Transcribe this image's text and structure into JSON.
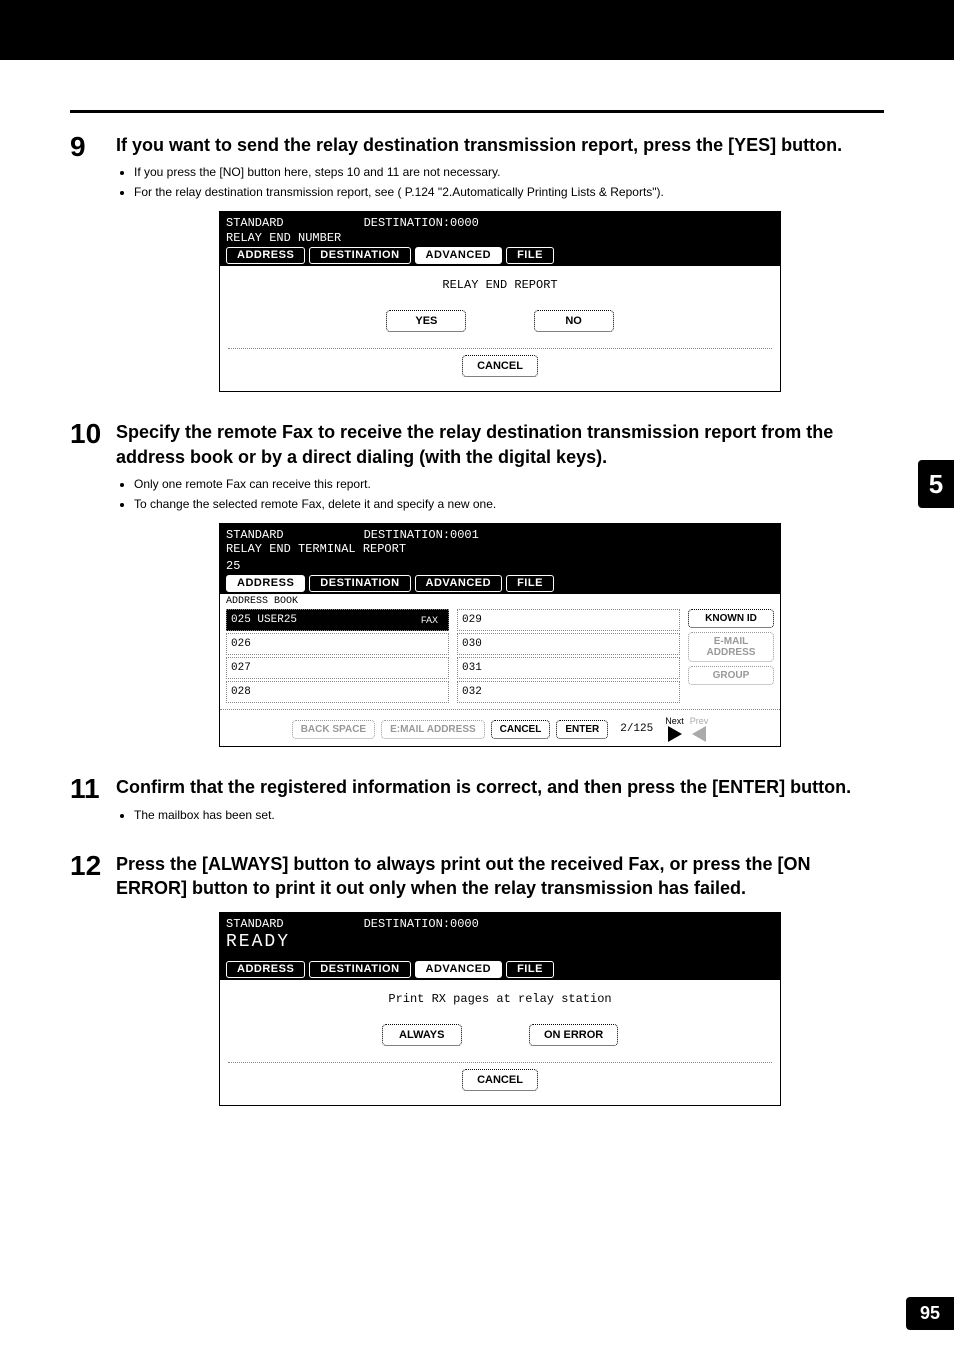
{
  "side_tab": "5",
  "page_number": "95",
  "steps": {
    "s9": {
      "num": "9",
      "title": "If you want to send the relay destination transmission report, press the [YES] button.",
      "bullets": [
        "If you press the [NO] button here, steps 10 and 11 are not necessary.",
        "For the relay destination transmission report, see ( P.124 \"2.Automatically Printing Lists & Reports\")."
      ]
    },
    "s10": {
      "num": "10",
      "title": "Specify the remote Fax to receive the relay destination transmission report from the address book or by a direct dialing (with the digital keys).",
      "bullets": [
        "Only one remote Fax can receive this report.",
        "To change the selected remote Fax, delete it and specify a new one."
      ]
    },
    "s11": {
      "num": "11",
      "title": "Confirm that the registered information is correct, and then press the [ENTER] button.",
      "bullets": [
        "The mailbox has been set."
      ]
    },
    "s12": {
      "num": "12",
      "title": "Press the [ALWAYS] button to always print out the received Fax, or press the [ON ERROR] button to print it out only when the relay transmission has failed."
    }
  },
  "tabs": {
    "address": "ADDRESS",
    "destination": "DESTINATION",
    "advanced": "ADVANCED",
    "file": "FILE"
  },
  "common_buttons": {
    "yes": "YES",
    "no": "NO",
    "cancel": "CANCEL",
    "enter": "ENTER",
    "always": "ALWAYS",
    "on_error": "ON ERROR",
    "back_space": "BACK SPACE",
    "multi": "E:MAIL ADDRESS",
    "known_id": "KNOWN ID",
    "mail_address": "E-MAIL ADDRESS",
    "group": "GROUP",
    "next": "Next",
    "prev": "Prev"
  },
  "screen1": {
    "mode": "STANDARD",
    "dest": "DESTINATION:0000",
    "subtitle": "RELAY END NUMBER",
    "body_label": "RELAY END REPORT"
  },
  "screen2": {
    "mode": "STANDARD",
    "dest": "DESTINATION:0001",
    "subtitle": "RELAY END TERMINAL REPORT",
    "input_val": "25",
    "section_label": "ADDRESS BOOK",
    "left_rows": [
      {
        "id": "025",
        "name": "USER25",
        "selected": true
      },
      {
        "id": "026",
        "name": "",
        "selected": false
      },
      {
        "id": "027",
        "name": "",
        "selected": false
      },
      {
        "id": "028",
        "name": "",
        "selected": false
      }
    ],
    "right_rows": [
      "029",
      "030",
      "031",
      "032"
    ],
    "fax_pill": "FAX",
    "page_counter": "2/125"
  },
  "screen3": {
    "mode": "STANDARD",
    "dest": "DESTINATION:0000",
    "ready": "READY",
    "body_label": "Print RX pages at relay station"
  }
}
